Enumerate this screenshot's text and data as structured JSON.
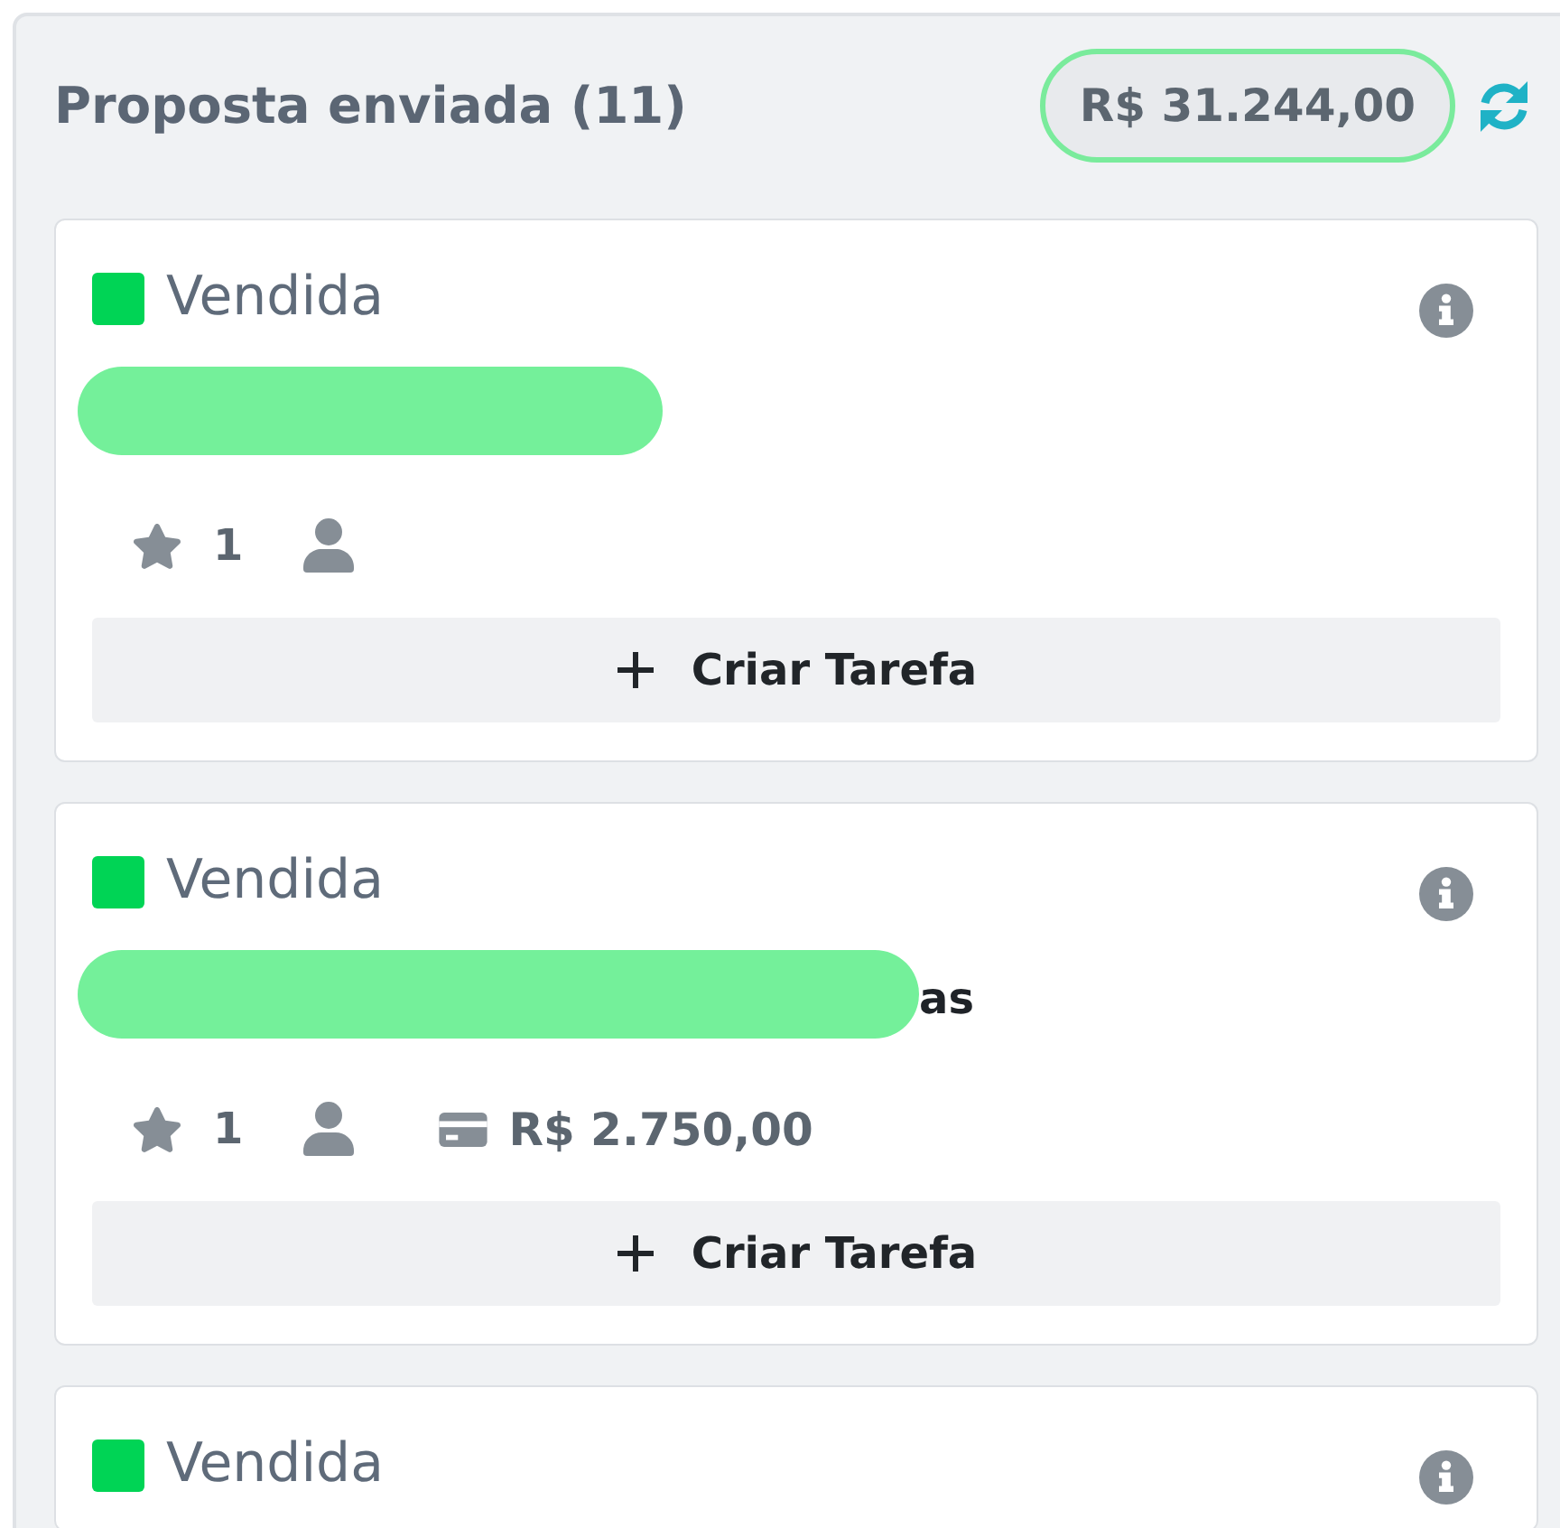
{
  "column": {
    "title": "Proposta enviada (11)",
    "total": {
      "text": "R$ 31.244,00",
      "highlighted": true
    }
  },
  "cards": [
    {
      "status": {
        "label": "Vendida",
        "color": "#00d455"
      },
      "title_redacted": true,
      "star_count": "1",
      "action": "Criar Tarefa"
    },
    {
      "status": {
        "label": "Vendida",
        "color": "#00d455"
      },
      "title_redacted": true,
      "title": "as",
      "star_count": "1",
      "value": "R$ 2.750,00",
      "action": "Criar Tarefa"
    },
    {
      "status": {
        "label": "Vendida",
        "color": "#00d455"
      }
    }
  ]
}
